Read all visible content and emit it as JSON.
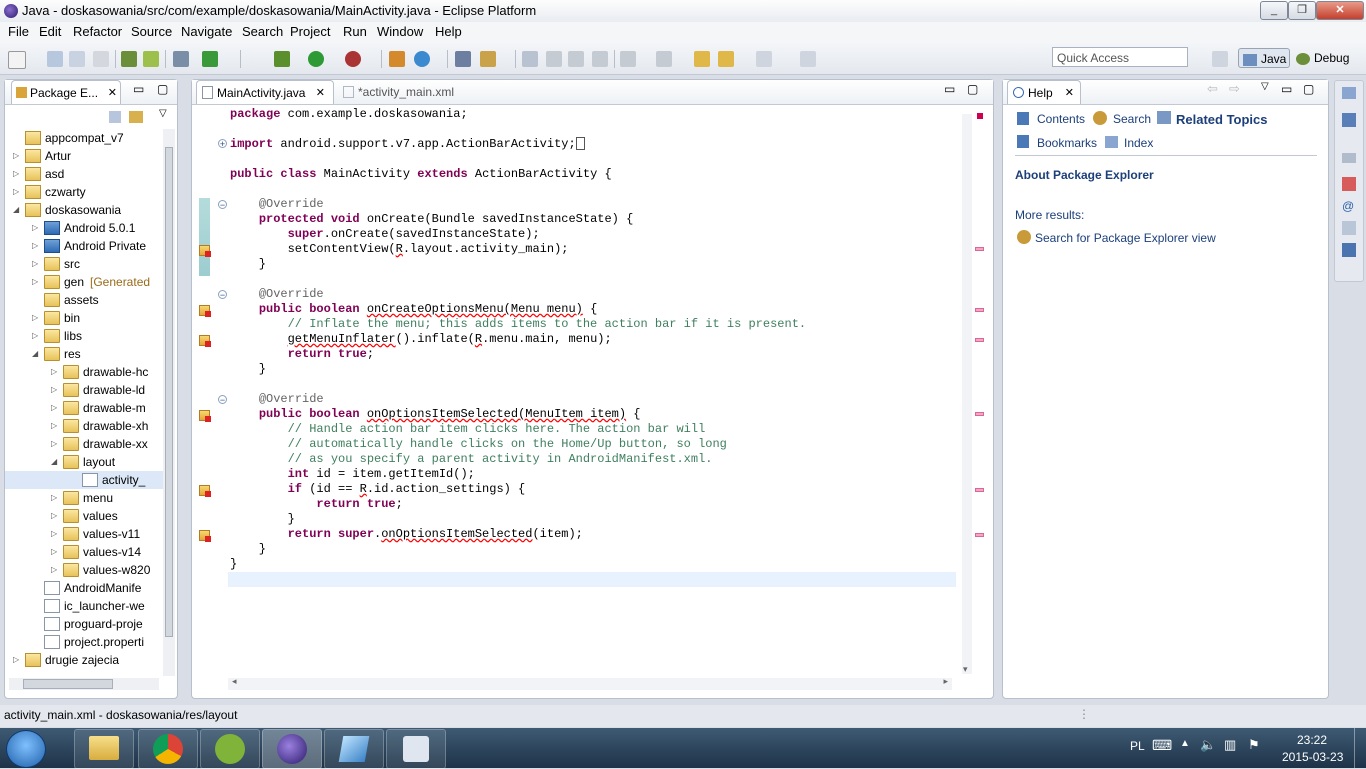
{
  "window": {
    "title": "Java - doskasowania/src/com/example/doskasowania/MainActivity.java - Eclipse Platform"
  },
  "menu": [
    "File",
    "Edit",
    "Refactor",
    "Source",
    "Navigate",
    "Search",
    "Project",
    "Run",
    "Window",
    "Help"
  ],
  "toolbar": {
    "quick_access_placeholder": "Quick Access",
    "perspective_java": "Java",
    "perspective_debug": "Debug"
  },
  "package_explorer": {
    "tab_label": "Package E...",
    "items": [
      {
        "label": "appcompat_v7",
        "twisty": "",
        "type": "proj"
      },
      {
        "label": "Artur",
        "twisty": "▷",
        "type": "proj"
      },
      {
        "label": "asd",
        "twisty": "▷",
        "type": "proj"
      },
      {
        "label": "czwarty",
        "twisty": "▷",
        "type": "proj"
      },
      {
        "label": "doskasowania",
        "twisty": "◢",
        "type": "proj"
      },
      {
        "label": "Android 5.0.1",
        "twisty": "▷",
        "type": "lib"
      },
      {
        "label": "Android Private",
        "twisty": "▷",
        "type": "lib"
      },
      {
        "label": "src",
        "twisty": "▷",
        "type": "folder"
      },
      {
        "label": "gen",
        "extra": "[Generated",
        "twisty": "▷",
        "type": "folder"
      },
      {
        "label": "assets",
        "twisty": "",
        "type": "folder"
      },
      {
        "label": "bin",
        "twisty": "▷",
        "type": "folder"
      },
      {
        "label": "libs",
        "twisty": "▷",
        "type": "folder"
      },
      {
        "label": "res",
        "twisty": "◢",
        "type": "folder"
      },
      {
        "label": "drawable-hc",
        "twisty": "▷",
        "type": "folder"
      },
      {
        "label": "drawable-ld",
        "twisty": "▷",
        "type": "folder"
      },
      {
        "label": "drawable-m",
        "twisty": "▷",
        "type": "folder"
      },
      {
        "label": "drawable-xh",
        "twisty": "▷",
        "type": "folder"
      },
      {
        "label": "drawable-xx",
        "twisty": "▷",
        "type": "folder"
      },
      {
        "label": "layout",
        "twisty": "◢",
        "type": "folder"
      },
      {
        "label": "activity_",
        "twisty": "",
        "type": "file"
      },
      {
        "label": "menu",
        "twisty": "▷",
        "type": "folder"
      },
      {
        "label": "values",
        "twisty": "▷",
        "type": "folder"
      },
      {
        "label": "values-v11",
        "twisty": "▷",
        "type": "folder"
      },
      {
        "label": "values-v14",
        "twisty": "▷",
        "type": "folder"
      },
      {
        "label": "values-w820",
        "twisty": "▷",
        "type": "folder"
      },
      {
        "label": "AndroidManife",
        "twisty": "",
        "type": "file"
      },
      {
        "label": "ic_launcher-we",
        "twisty": "",
        "type": "file"
      },
      {
        "label": "proguard-proje",
        "twisty": "",
        "type": "file"
      },
      {
        "label": "project.properti",
        "twisty": "",
        "type": "file"
      },
      {
        "label": "drugie zajecia",
        "twisty": "▷",
        "type": "proj"
      }
    ]
  },
  "editor": {
    "tabs": [
      "MainActivity.java",
      "*activity_main.xml"
    ]
  },
  "help": {
    "tab_label": "Help",
    "nav": {
      "contents": "Contents",
      "search": "Search",
      "related": "Related Topics",
      "bookmarks": "Bookmarks",
      "index": "Index"
    },
    "heading": "About Package Explorer",
    "more_results": "More results:",
    "search_link": "Search for Package Explorer view"
  },
  "status": {
    "text": "activity_main.xml - doskasowania/res/layout"
  },
  "taskbar": {
    "lang": "PL",
    "time": "23:22",
    "date": "2015-03-23"
  }
}
